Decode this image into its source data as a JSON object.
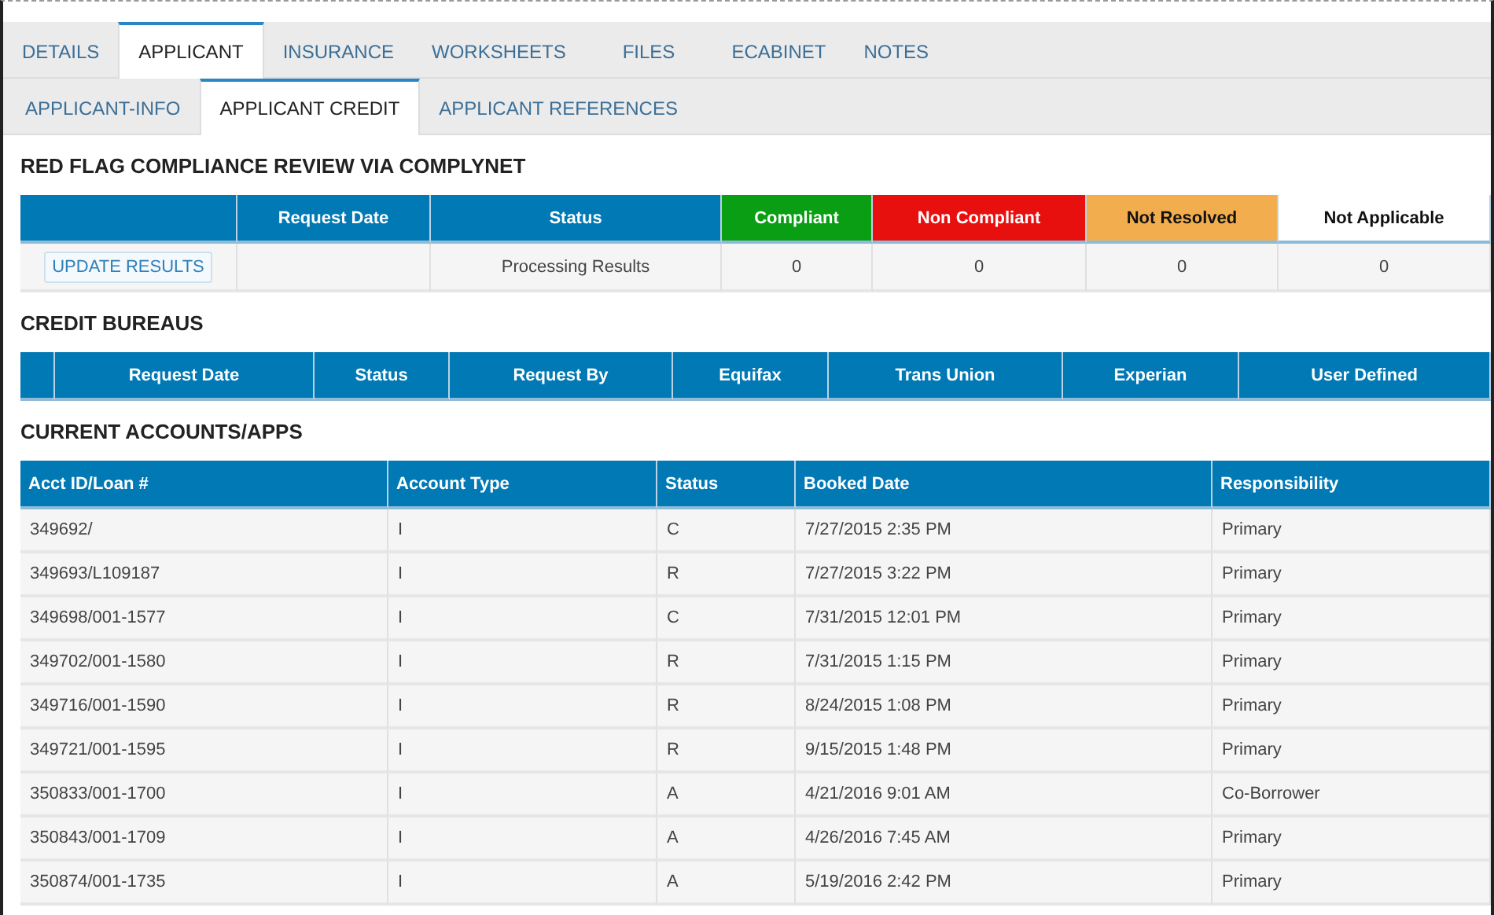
{
  "tabs": [
    {
      "label": "DETAILS",
      "selected": false
    },
    {
      "label": "APPLICANT",
      "selected": true
    },
    {
      "label": "INSURANCE",
      "selected": false
    },
    {
      "label": "WORKSHEETS",
      "selected": false
    },
    {
      "label": "FILES",
      "selected": false
    },
    {
      "label": "ECABINET",
      "selected": false
    },
    {
      "label": "NOTES",
      "selected": false
    }
  ],
  "sub_tabs": [
    {
      "label": "APPLICANT-INFO",
      "selected": false
    },
    {
      "label": "APPLICANT CREDIT",
      "selected": true
    },
    {
      "label": "APPLICANT REFERENCES",
      "selected": false
    }
  ],
  "compliance": {
    "title": "RED FLAG COMPLIANCE REVIEW VIA COMPLYNET",
    "columns": [
      {
        "color": "#0079b5"
      },
      {
        "label": "Request Date",
        "color": "#0079b5"
      },
      {
        "label": "Status",
        "color": "#0079b5"
      },
      {
        "label": "Compliant",
        "color": "#0a9e14"
      },
      {
        "label": "Non Compliant",
        "color": "#e8100f"
      },
      {
        "label": "Not Resolved",
        "color": "#f2ae4e"
      },
      {
        "label": "Not Applicable",
        "color": "#ffffff"
      }
    ],
    "row": {
      "action": "UPDATE RESULTS",
      "status": "Processing Results",
      "counts": [
        "0",
        "0",
        "0",
        "0"
      ]
    }
  },
  "credit_bureaus": {
    "title": "CREDIT BUREAUS",
    "columns": [
      "Request Date",
      "Status",
      "Request By",
      "Equifax",
      "Trans Union",
      "Experian",
      "User Defined"
    ]
  },
  "accounts": {
    "title": "CURRENT ACCOUNTS/APPS",
    "columns": [
      "Acct ID/Loan #",
      "Account Type",
      "Status",
      "Booked Date",
      "Responsibility"
    ],
    "rows": [
      [
        "349692/",
        "I",
        "C",
        "7/27/2015 2:35 PM",
        "Primary"
      ],
      [
        "349693/L109187",
        "I",
        "R",
        "7/27/2015 3:22 PM",
        "Primary"
      ],
      [
        "349698/001-1577",
        "I",
        "C",
        "7/31/2015 12:01 PM",
        "Primary"
      ],
      [
        "349702/001-1580",
        "I",
        "R",
        "7/31/2015 1:15 PM",
        "Primary"
      ],
      [
        "349716/001-1590",
        "I",
        "R",
        "8/24/2015 1:08 PM",
        "Primary"
      ],
      [
        "349721/001-1595",
        "I",
        "R",
        "9/15/2015 1:48 PM",
        "Primary"
      ],
      [
        "350833/001-1700",
        "I",
        "A",
        "4/21/2016 9:01 AM",
        "Co-Borrower"
      ],
      [
        "350843/001-1709",
        "I",
        "A",
        "4/26/2016 7:45 AM",
        "Primary"
      ],
      [
        "350874/001-1735",
        "I",
        "A",
        "5/19/2016 2:42 PM",
        "Primary"
      ]
    ]
  }
}
